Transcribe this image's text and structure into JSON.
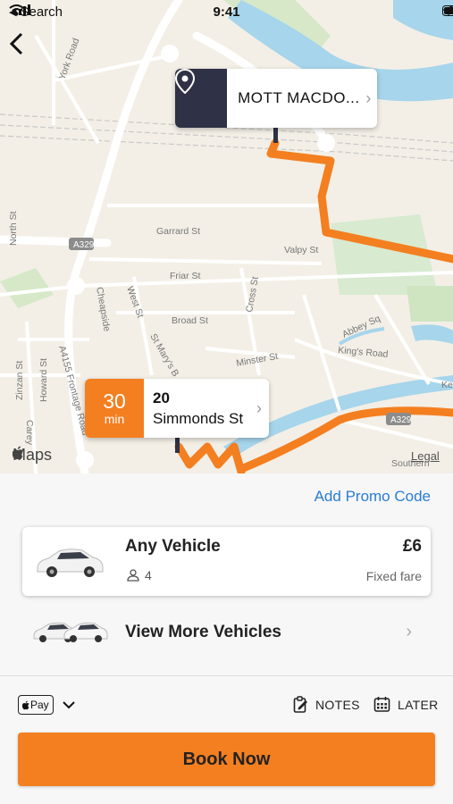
{
  "status_bar": {
    "back_app": "Search",
    "time": "9:41"
  },
  "map": {
    "destination": {
      "name": "MOTT MACDO..."
    },
    "pickup": {
      "eta_value": "30",
      "eta_unit": "min",
      "address_line1": "20",
      "address_line2": "Simmonds St"
    },
    "street_labels": [
      "York Road",
      "North St",
      "Garrard St",
      "Valpy St",
      "Friar St",
      "Cheapside",
      "West St",
      "St Mary's B",
      "Broad St",
      "Cross St",
      "Minster St",
      "Abbey Sq",
      "King's Road",
      "A4155 Frontage Road",
      "Howard St",
      "Zinzan St",
      "Carey",
      "A329",
      "A329",
      "Southern",
      "Kenn"
    ],
    "maps_brand": "Maps",
    "legal": "Legal",
    "route_color": "#f47f20"
  },
  "sheet": {
    "promo": "Add Promo Code",
    "vehicle": {
      "name": "Any Vehicle",
      "seats": "4",
      "price": "£6",
      "fare_type": "Fixed fare"
    },
    "more_vehicles": "View More Vehicles",
    "payment": {
      "method": "Pay"
    },
    "notes": "NOTES",
    "later": "LATER",
    "book": "Book Now"
  },
  "colors": {
    "accent": "#f47f20",
    "link": "#2a7cd4",
    "pin_bg": "#2f3146"
  }
}
